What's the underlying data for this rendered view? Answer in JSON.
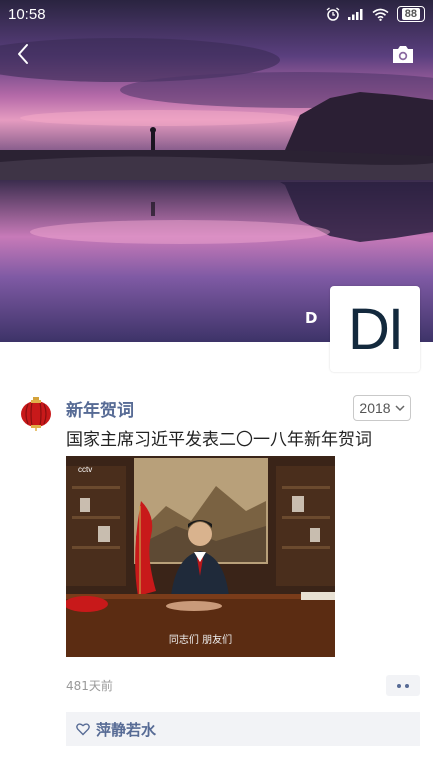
{
  "status_bar": {
    "time": "10:58",
    "battery": "88"
  },
  "profile": {
    "name": "D",
    "avatar_text": "DI"
  },
  "post": {
    "author": "新年贺词",
    "year": "2018",
    "text": "国家主席习近平发表二〇一八年新年贺词",
    "video_channel": "cctv",
    "video_subtitle": "同志们 朋友们",
    "time_ago": "481天前",
    "likes": [
      "萍静若水"
    ]
  },
  "icons": [
    "back-icon",
    "camera-icon",
    "alarm-icon",
    "signal-icon",
    "wifi-icon",
    "battery-icon",
    "lantern-icon",
    "chevron-down-icon",
    "heart-icon",
    "more-icon"
  ]
}
